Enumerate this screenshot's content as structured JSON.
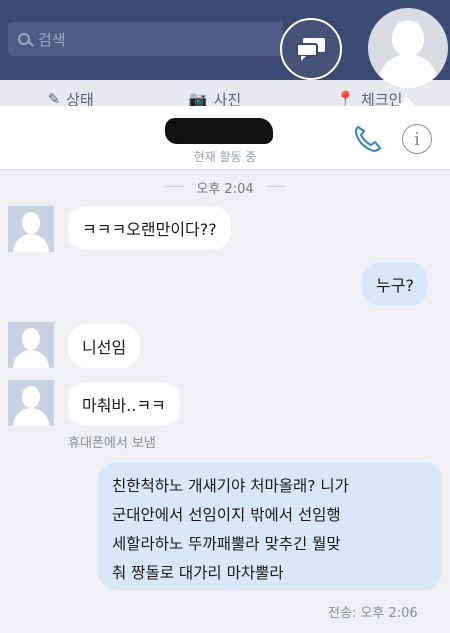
{
  "background_app": {
    "search_placeholder": "검색",
    "actions": [
      {
        "icon": "pencil-square-icon",
        "label": "상태"
      },
      {
        "icon": "camera-icon",
        "label": "사진"
      },
      {
        "icon": "location-pin-icon",
        "label": "체크인"
      }
    ]
  },
  "chat_header": {
    "status": "현재 활동 중",
    "call_icon": "phone-icon",
    "info_icon": "info-icon"
  },
  "conversation": {
    "timestamp": "오후 2:04",
    "messages": [
      {
        "side": "in",
        "text": "ㅋㅋㅋ오랜만이다??"
      },
      {
        "side": "out",
        "text": "누구?"
      },
      {
        "side": "in",
        "text": "니선임"
      },
      {
        "side": "in",
        "text": "마춰바..ㅋㅋ",
        "sub": "휴대폰에서 보냄"
      },
      {
        "side": "out",
        "lines": [
          "친한척하노 개새기야 처마올래? 니가",
          "군대안에서 선임이지 밖에서 선임행",
          "세할라하노 뚜까패뿔라 맞추긴 뭘맞",
          "춰 짱돌로 대가리 마차뿔라"
        ],
        "sub": "전송: 오후 2:06"
      }
    ]
  }
}
